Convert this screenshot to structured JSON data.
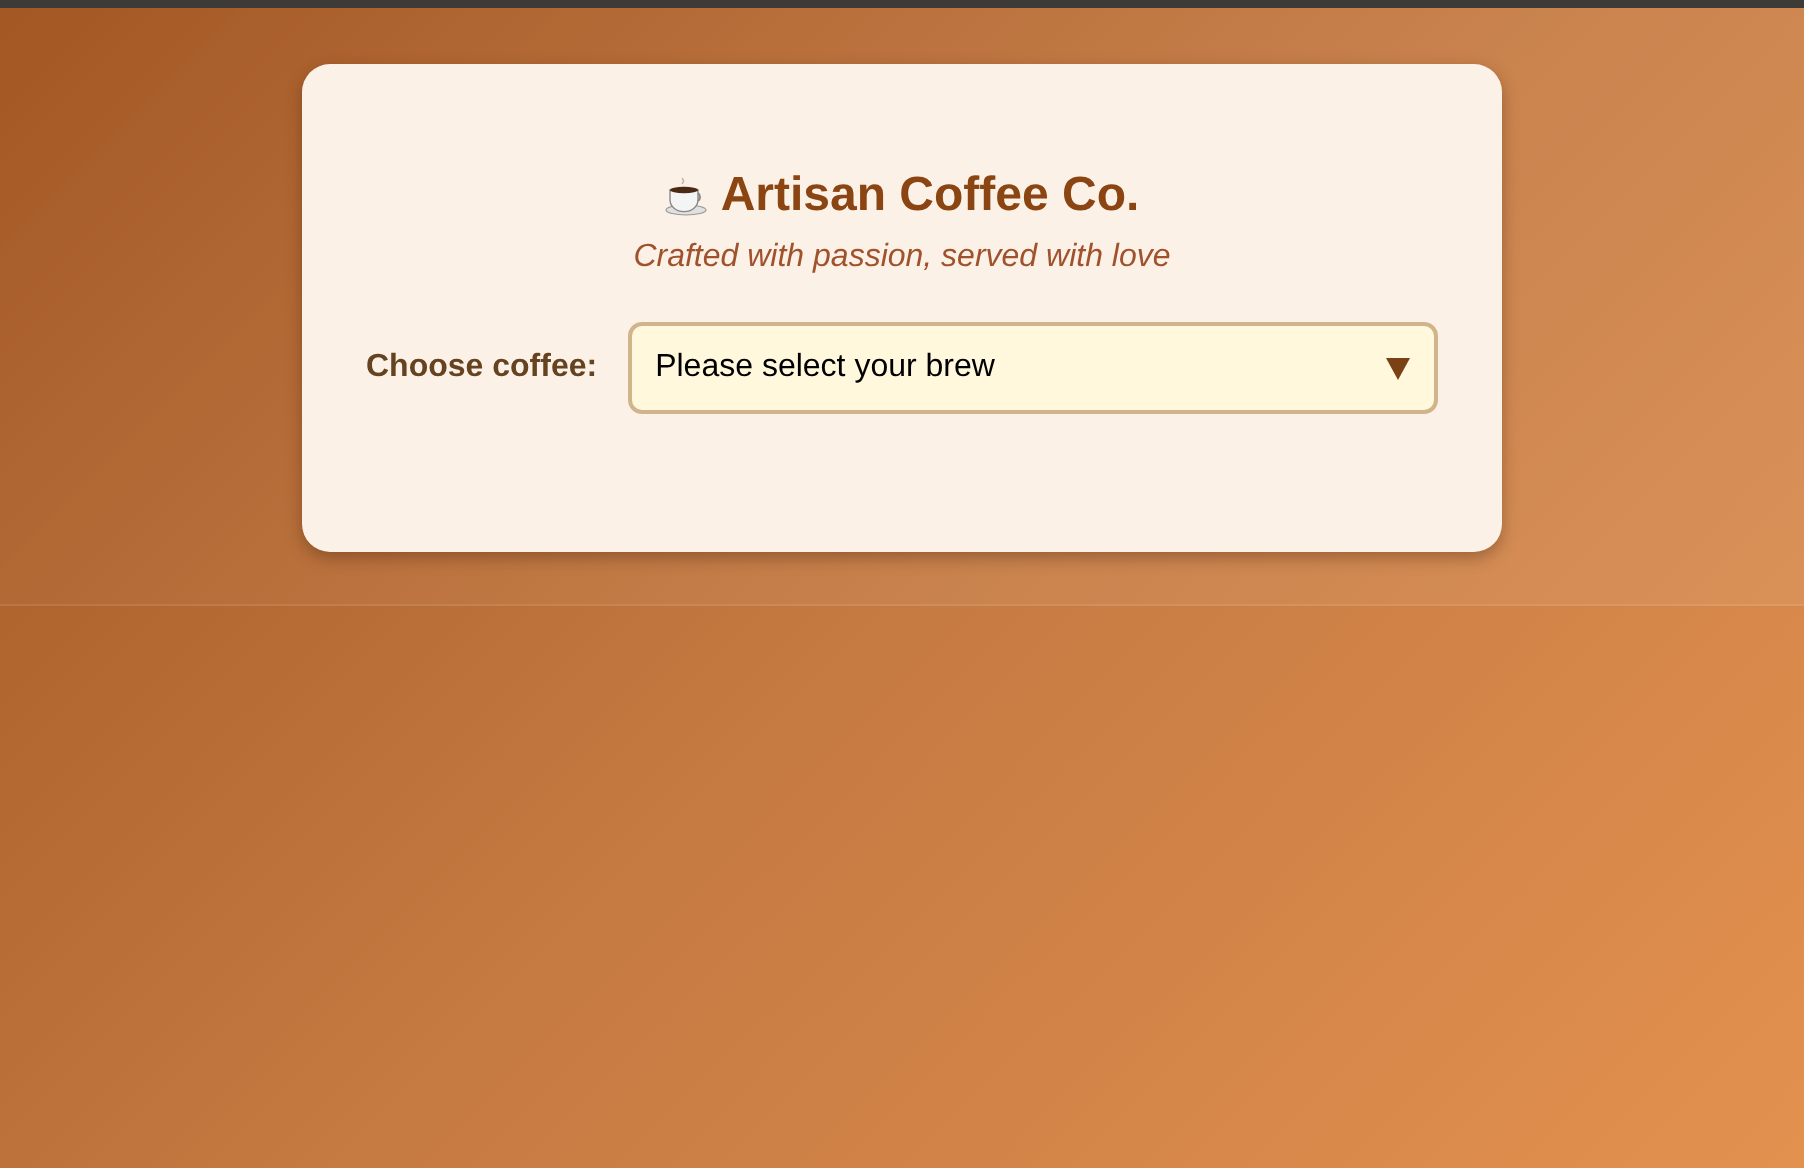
{
  "header": {
    "title": "Artisan Coffee Co.",
    "tagline": "Crafted with passion, served with love"
  },
  "selector": {
    "label": "Choose coffee:",
    "value": "Please select your brew",
    "expanded": false
  }
}
